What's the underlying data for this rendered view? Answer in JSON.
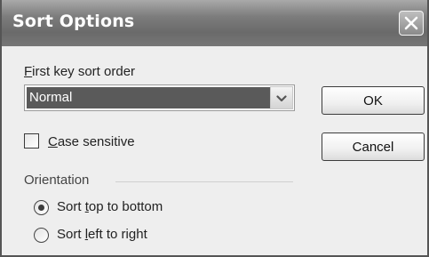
{
  "window": {
    "title": "Sort Options",
    "close_icon": "close-icon"
  },
  "sort_order": {
    "label_accel": "F",
    "label_rest": "irst key sort order",
    "selected": "Normal"
  },
  "buttons": {
    "ok": "OK",
    "cancel": "Cancel"
  },
  "case_sensitive": {
    "label_accel": "C",
    "label_rest": "ase sensitive",
    "checked": false
  },
  "orientation": {
    "group_label": "Orientation",
    "options": [
      {
        "pre": "Sort ",
        "accel": "t",
        "post": "op to bottom",
        "selected": true
      },
      {
        "pre": "Sort ",
        "accel": "l",
        "post": "eft to right",
        "selected": false
      }
    ]
  }
}
